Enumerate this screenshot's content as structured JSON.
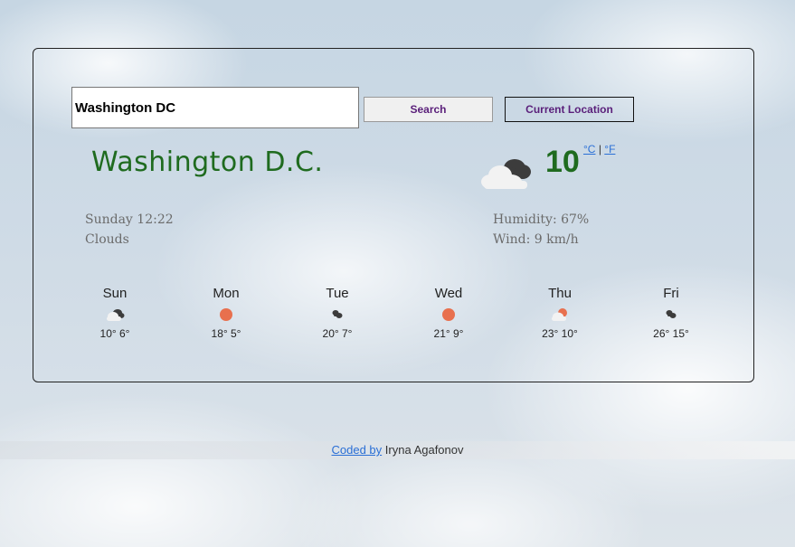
{
  "search": {
    "value": "Washington DC",
    "search_label": "Search",
    "location_label": "Current Location"
  },
  "current": {
    "city": "Washington D.C.",
    "temperature": "10",
    "unit_c": "°C",
    "unit_separator": "|",
    "unit_f": "°F",
    "icon": "broken-clouds-icon",
    "datetime": "Sunday 12:22",
    "description": "Clouds",
    "humidity": "Humidity: 67%",
    "wind": "Wind: 9 km/h"
  },
  "forecast": [
    {
      "day": "Sun",
      "temps": "10° 6°",
      "icon": "broken-clouds-icon"
    },
    {
      "day": "Mon",
      "temps": "18° 5°",
      "icon": "clear-sun-icon"
    },
    {
      "day": "Tue",
      "temps": "20° 7°",
      "icon": "dark-clouds-icon"
    },
    {
      "day": "Wed",
      "temps": "21° 9°",
      "icon": "clear-sun-icon"
    },
    {
      "day": "Thu",
      "temps": "23° 10°",
      "icon": "sun-behind-cloud-icon"
    },
    {
      "day": "Fri",
      "temps": "26° 15°",
      "icon": "dark-clouds-icon"
    }
  ],
  "footer": {
    "link_text": "Coded by",
    "author": " Iryna Agafonov"
  },
  "colors": {
    "accent_green": "#1f6b1f",
    "button_text": "#5a1f7a",
    "link_blue": "#2a6fd6",
    "sun": "#e8704e"
  }
}
